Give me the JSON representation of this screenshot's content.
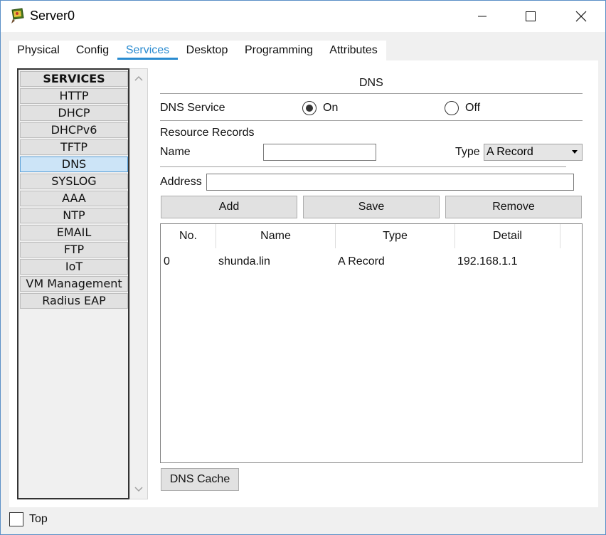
{
  "window": {
    "title": "Server0"
  },
  "tabs": [
    {
      "label": "Physical"
    },
    {
      "label": "Config"
    },
    {
      "label": "Services"
    },
    {
      "label": "Desktop"
    },
    {
      "label": "Programming"
    },
    {
      "label": "Attributes"
    }
  ],
  "sidebar": {
    "header": "SERVICES",
    "items": [
      {
        "label": "HTTP"
      },
      {
        "label": "DHCP"
      },
      {
        "label": "DHCPv6"
      },
      {
        "label": "TFTP"
      },
      {
        "label": "DNS"
      },
      {
        "label": "SYSLOG"
      },
      {
        "label": "AAA"
      },
      {
        "label": "NTP"
      },
      {
        "label": "EMAIL"
      },
      {
        "label": "FTP"
      },
      {
        "label": "IoT"
      },
      {
        "label": "VM Management"
      },
      {
        "label": "Radius EAP"
      }
    ]
  },
  "dns": {
    "heading": "DNS",
    "service_label": "DNS Service",
    "on_label": "On",
    "off_label": "Off",
    "resource_records_label": "Resource Records",
    "name_label": "Name",
    "name_value": "",
    "type_label": "Type",
    "type_value": "A Record",
    "address_label": "Address",
    "address_value": "",
    "add_button": "Add",
    "save_button": "Save",
    "remove_button": "Remove",
    "cache_button": "DNS Cache"
  },
  "records_table": {
    "columns": [
      "No.",
      "Name",
      "Type",
      "Detail"
    ],
    "rows": [
      [
        "0",
        "shunda.lin",
        "A Record",
        "192.168.1.1"
      ]
    ]
  },
  "footer": {
    "top_label": "Top"
  }
}
